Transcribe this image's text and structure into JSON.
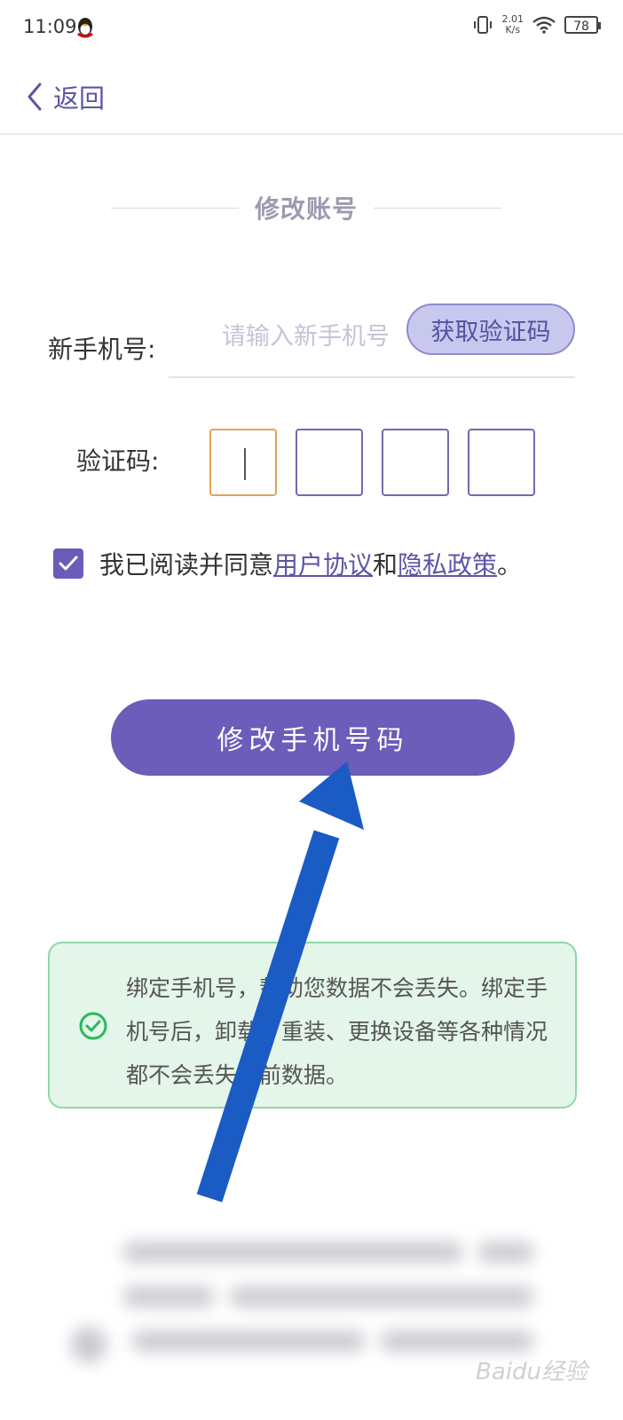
{
  "status_bar": {
    "time": "11:09",
    "net_speed_value": "2.01",
    "net_speed_unit": "K/s",
    "battery": "78"
  },
  "nav": {
    "back_label": "返回"
  },
  "section_title": "修改账号",
  "form": {
    "phone_label": "新手机号:",
    "phone_placeholder": "请输入新手机号",
    "get_code_label": "获取验证码",
    "code_label": "验证码:"
  },
  "agreement": {
    "prefix": "我已阅读并同意",
    "user_agreement": "用户协议",
    "conjunction": "和",
    "privacy_policy": "隐私政策",
    "suffix": "。",
    "checked": true
  },
  "submit_label": "修改手机号码",
  "info": {
    "text": "绑定手机号，帮助您数据不会丢失。绑定手机号后，卸载、重装、更换设备等各种情况都不会丢失之前数据。"
  },
  "watermark": "Baidu经验",
  "colors": {
    "accent": "#6b5db9",
    "info_bg": "#e4f5ea",
    "info_border": "#8fd8a8",
    "annotation_arrow": "#1b5bc4"
  }
}
